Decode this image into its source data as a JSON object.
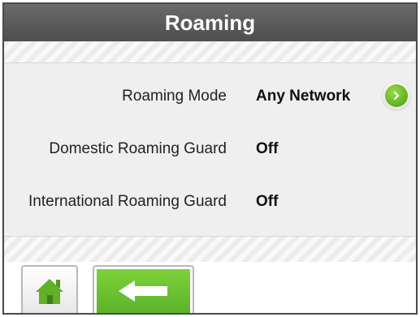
{
  "header": {
    "title": "Roaming"
  },
  "settings": [
    {
      "label": "Roaming Mode",
      "value": "Any Network"
    },
    {
      "label": "Domestic Roaming Guard",
      "value": "Off"
    },
    {
      "label": "International Roaming Guard",
      "value": "Off"
    }
  ],
  "icons": {
    "go": "chevron-right-icon",
    "home": "home-icon",
    "back": "arrow-left-icon"
  },
  "colors": {
    "header": "#555555",
    "accent_green": "#6cc12e",
    "background": "#efefef"
  }
}
